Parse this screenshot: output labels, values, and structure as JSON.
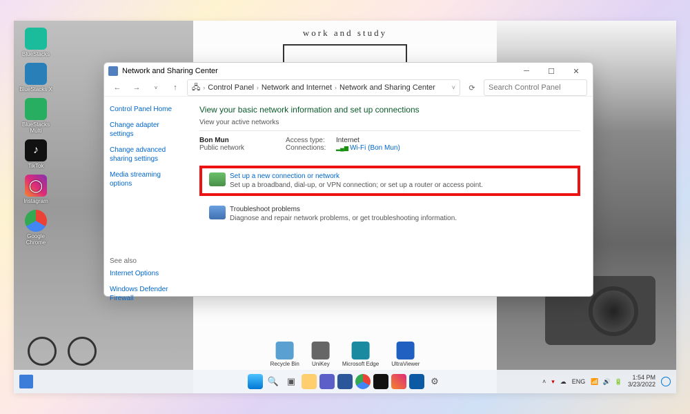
{
  "wallpaper": {
    "center_label": "work and study"
  },
  "desktop_icons": [
    {
      "label": "BlueStacks",
      "color": "#1abc9c"
    },
    {
      "label": "BlueStacks X",
      "color": "#2980b9"
    },
    {
      "label": "BlueStacks Multi",
      "color": "#27ae60"
    },
    {
      "label": "TikTok",
      "color": "#111"
    },
    {
      "label": "Instagram",
      "color": "linear-gradient(45deg,#f58529,#dd2a7b,#8134af)"
    },
    {
      "label": "Google Chrome",
      "color": "#fff"
    }
  ],
  "window": {
    "title": "Network and Sharing Center",
    "breadcrumb": [
      "Control Panel",
      "Network and Internet",
      "Network and Sharing Center"
    ],
    "search_placeholder": "Search Control Panel",
    "sidebar": {
      "home": "Control Panel Home",
      "links": [
        "Change adapter settings",
        "Change advanced sharing settings",
        "Media streaming options"
      ],
      "seealso_label": "See also",
      "seealso": [
        "Internet Options",
        "Windows Defender Firewall"
      ]
    },
    "main": {
      "heading": "View your basic network information and set up connections",
      "sub": "View your active networks",
      "network_name": "Bon Mun",
      "network_type": "Public network",
      "access_label": "Access type:",
      "access_value": "Internet",
      "conn_label": "Connections:",
      "conn_value": "Wi-Fi (Bon Mun)",
      "setup_title": "Set up a new connection or network",
      "setup_desc": "Set up a broadband, dial-up, or VPN connection; or set up a router or access point.",
      "trouble_title": "Troubleshoot problems",
      "trouble_desc": "Diagnose and repair network problems, or get troubleshooting information."
    }
  },
  "bottom_icons": [
    {
      "label": "Recycle Bin",
      "color": "#5aa0d0"
    },
    {
      "label": "UniKey",
      "color": "#666"
    },
    {
      "label": "Microsoft Edge",
      "color": "#1a8aa0"
    },
    {
      "label": "UltraViewer",
      "color": "#2060c0"
    }
  ],
  "taskbar": {
    "lang": "ENG",
    "time": "1:54 PM",
    "date": "3/23/2022"
  }
}
